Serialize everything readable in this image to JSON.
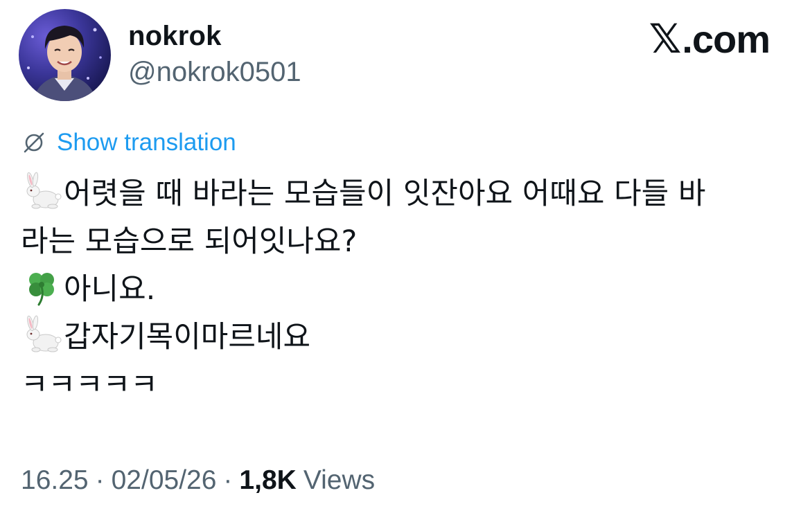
{
  "header": {
    "display_name": "nokrok",
    "handle": "@nokrok0501",
    "brand_mark": "𝕏",
    "brand_text": ".com"
  },
  "translate": {
    "label": "Show translation",
    "icon": "globe-off-icon",
    "color": "#1d9bf0"
  },
  "tweet": {
    "lines": [
      {
        "emoji": "rabbit-icon",
        "text": "어렷을 때 바라는 모습들이 잇잔아요 어때요 다들 바"
      },
      {
        "emoji": "",
        "text": "라는 모습으로 되어잇나요?"
      },
      {
        "emoji": "four-leaf-clover-icon",
        "text": "아니요."
      },
      {
        "emoji": "rabbit-icon",
        "text": "갑자기목이마르네요"
      },
      {
        "emoji": "",
        "text": "ㅋㅋㅋㅋㅋ"
      }
    ]
  },
  "meta": {
    "time": "16.25",
    "date": "02/05/26",
    "separator": "·",
    "views_count": "1,8K",
    "views_label": "Views"
  },
  "colors": {
    "text": "#0f1419",
    "secondary": "#536471",
    "link": "#1d9bf0"
  }
}
